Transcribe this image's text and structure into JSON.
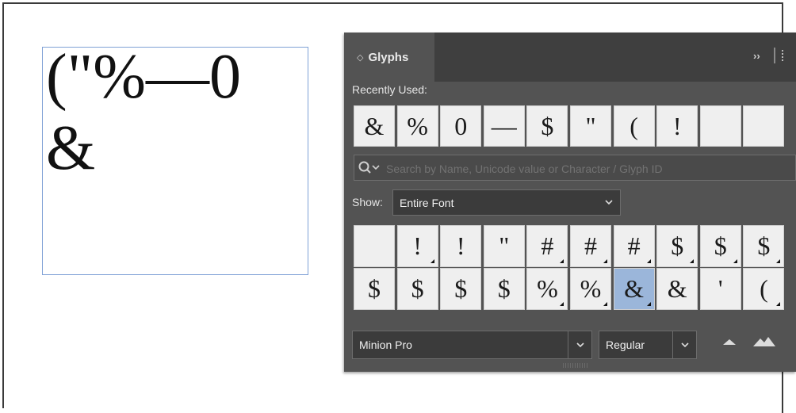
{
  "document": {
    "text_line1": "(\"%—0",
    "text_line2": "&"
  },
  "panel": {
    "tab_title": "Glyphs",
    "recent_label": "Recently Used:",
    "recent_glyphs": [
      "&",
      "%",
      "0",
      "—",
      "$",
      "\"",
      "(",
      "!",
      "",
      ""
    ],
    "search_placeholder": "Search by Name, Unicode value or Character / Glyph ID",
    "show_label": "Show:",
    "show_value": "Entire Font",
    "grid_row1": [
      {
        "g": "",
        "alt": false
      },
      {
        "g": "!",
        "alt": true
      },
      {
        "g": "!",
        "alt": false
      },
      {
        "g": "\"",
        "alt": false
      },
      {
        "g": "#",
        "alt": true
      },
      {
        "g": "#",
        "alt": true
      },
      {
        "g": "#",
        "alt": true
      },
      {
        "g": "$",
        "alt": true
      },
      {
        "g": "$",
        "alt": true
      },
      {
        "g": "$",
        "alt": true
      }
    ],
    "grid_row2": [
      {
        "g": "$",
        "alt": false
      },
      {
        "g": "$",
        "alt": false
      },
      {
        "g": "$",
        "alt": false
      },
      {
        "g": "$",
        "alt": false
      },
      {
        "g": "%",
        "alt": true
      },
      {
        "g": "%",
        "alt": true
      },
      {
        "g": "&",
        "alt": true,
        "selected": true
      },
      {
        "g": "&",
        "alt": false
      },
      {
        "g": "'",
        "alt": false
      },
      {
        "g": "(",
        "alt": true
      }
    ],
    "font_family": "Minion Pro",
    "font_style": "Regular"
  },
  "colors": {
    "panel_bg": "#535353",
    "selection": "#9bb6da",
    "frame_border": "#7fa1d6"
  }
}
